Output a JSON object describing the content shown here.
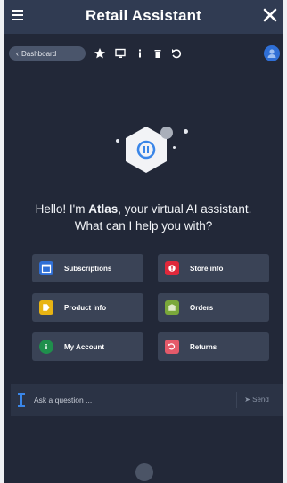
{
  "header": {
    "title": "Retail Assistant"
  },
  "toolbar": {
    "dashboard_label": "Dashboard"
  },
  "greeting": {
    "line1_pre": "Hello! I'm ",
    "name": "Atlas",
    "line1_post": ", your virtual AI assistant.",
    "line2": "What can I help you with?"
  },
  "actions": [
    {
      "label": "Subscriptions",
      "icon": "calendar-icon",
      "color": "#2f6fd6"
    },
    {
      "label": "Store info",
      "icon": "store-icon",
      "color": "#e0283b"
    },
    {
      "label": "Product info",
      "icon": "tag-icon",
      "color": "#e8b413"
    },
    {
      "label": "Orders",
      "icon": "box-icon",
      "color": "#7aa83a"
    },
    {
      "label": "My Account",
      "icon": "account-icon",
      "color": "#1f8f4c"
    },
    {
      "label": "Returns",
      "icon": "returns-icon",
      "color": "#e45a6a"
    }
  ],
  "composer": {
    "placeholder": "Ask a question ...",
    "send_label": "Send"
  },
  "colors": {
    "panel_bg": "#222838",
    "titlebar_bg": "#303b52",
    "accent": "#2f6fd6"
  }
}
